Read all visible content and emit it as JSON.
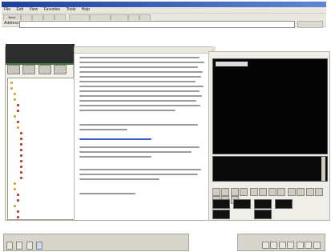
{
  "window": {
    "title": ""
  },
  "menu": [
    "File",
    "Edit",
    "View",
    "Favorites",
    "Tools",
    "Help"
  ],
  "toolbar": {
    "back_label": "Back",
    "buttons": [
      "",
      "",
      "",
      "",
      "",
      "",
      "",
      "",
      ""
    ]
  },
  "address": {
    "label": "Address",
    "value": "",
    "go_label": ""
  },
  "sidebar": {
    "logo_text": "",
    "icons": [
      "",
      "",
      "",
      ""
    ],
    "tree": [
      "",
      "",
      "",
      "",
      "",
      "",
      "",
      "",
      "",
      "",
      "",
      "",
      "",
      "",
      "",
      "",
      "",
      "",
      "",
      "",
      "",
      "",
      "",
      "",
      ""
    ]
  },
  "content": {
    "heading": ""
  },
  "viewer": {
    "label": "",
    "link": ""
  },
  "taskbar_left": {
    "title": "",
    "tabs": [
      "",
      "",
      "",
      ""
    ]
  },
  "taskbar_right": {
    "title": ""
  }
}
